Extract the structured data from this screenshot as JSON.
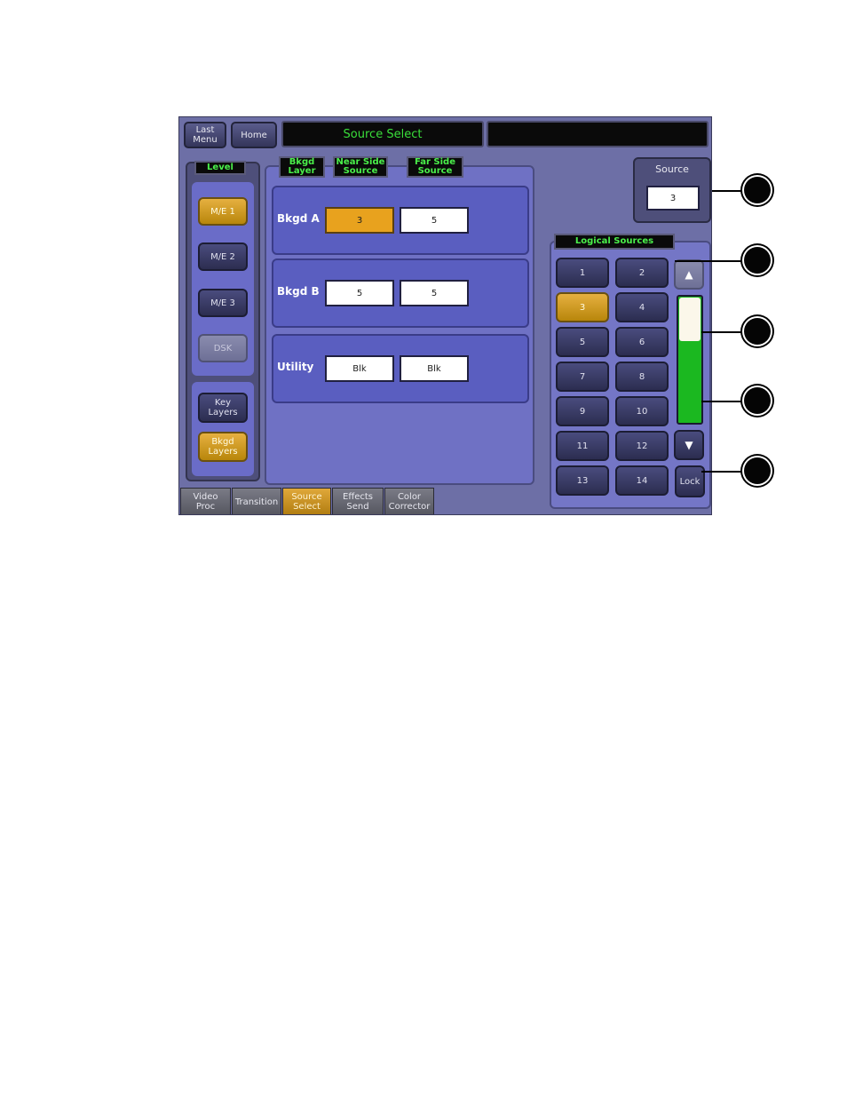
{
  "header": {
    "last_menu_label": "Last\nMenu",
    "home_label": "Home",
    "title": "Source Select",
    "status": ""
  },
  "level": {
    "label": "Level",
    "items": [
      {
        "label": "M/E 1",
        "state": "selected"
      },
      {
        "label": "M/E 2",
        "state": "normal"
      },
      {
        "label": "M/E 3",
        "state": "normal"
      },
      {
        "label": "DSK",
        "state": "disabled"
      }
    ],
    "layers": [
      {
        "label": "Key\nLayers",
        "state": "normal"
      },
      {
        "label": "Bkgd\nLayers",
        "state": "selected"
      }
    ]
  },
  "columns": {
    "bkgd_layer": "Bkgd\nLayer",
    "near_side": "Near Side\nSource",
    "far_side": "Far Side\nSource"
  },
  "rows": [
    {
      "label": "Bkgd A",
      "near": "3",
      "far": "5",
      "near_selected": true
    },
    {
      "label": "Bkgd B",
      "near": "5",
      "far": "5",
      "near_selected": false
    },
    {
      "label": "Utility",
      "near": "Blk",
      "far": "Blk",
      "near_selected": false
    }
  ],
  "source": {
    "label": "Source",
    "value": "3"
  },
  "logical_sources": {
    "label": "Logical Sources",
    "buttons": [
      "1",
      "2",
      "3",
      "4",
      "5",
      "6",
      "7",
      "8",
      "9",
      "10",
      "11",
      "12",
      "13",
      "14"
    ],
    "selected": "3",
    "lock_label": "Lock",
    "scroll_position": 0.0
  },
  "tabs": [
    {
      "label": "Video\nProc",
      "selected": false
    },
    {
      "label": "Transition",
      "selected": false
    },
    {
      "label": "Source\nSelect",
      "selected": true
    },
    {
      "label": "Effects\nSend",
      "selected": false
    },
    {
      "label": "Color\nCorrector",
      "selected": false
    }
  ],
  "colors": {
    "accent_selected": "#e8a21e",
    "title_text": "#3adf3a",
    "scroll_green": "#1bb820",
    "panel_blue": "#5a5ec0"
  }
}
